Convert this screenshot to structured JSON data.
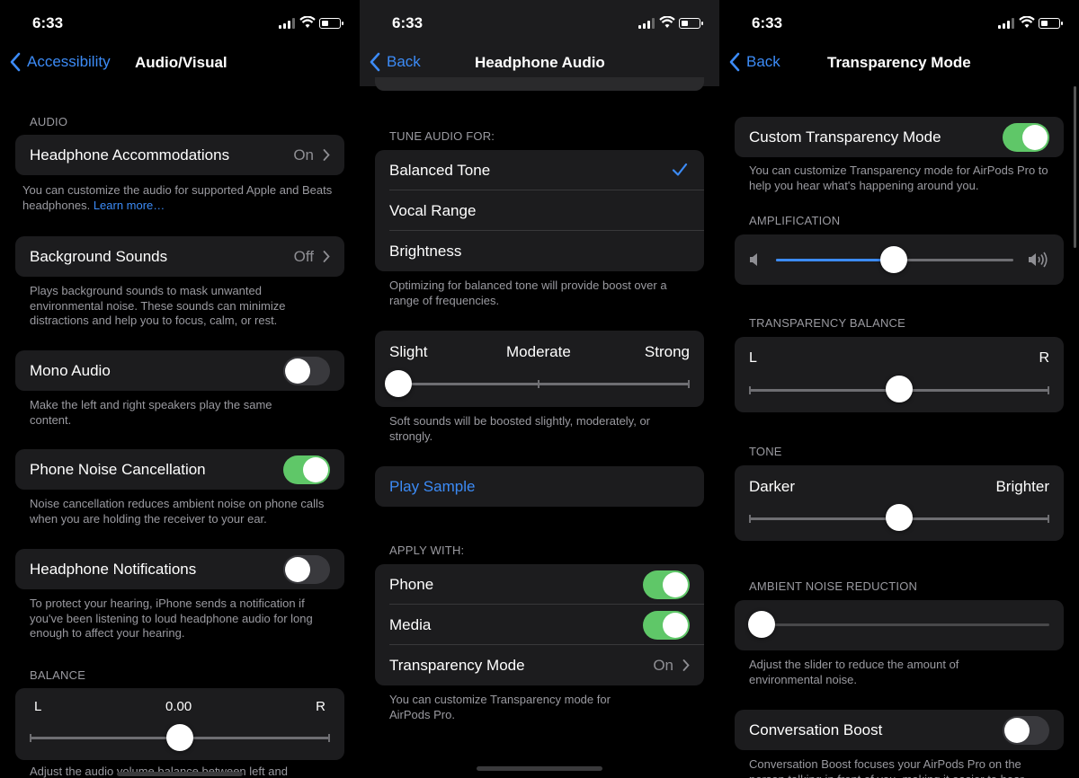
{
  "status": {
    "time": "6:33"
  },
  "panel1": {
    "nav": {
      "back": "Accessibility",
      "title": "Audio/Visual"
    },
    "audio_header": "AUDIO",
    "headphone_accommodations": {
      "label": "Headphone Accommodations",
      "value": "On"
    },
    "ha_footer": "You can customize the audio for supported Apple and Beats headphones.",
    "ha_link": "Learn more…",
    "background_sounds": {
      "label": "Background Sounds",
      "value": "Off"
    },
    "bs_footer": "Plays background sounds to mask unwanted environmental noise. These sounds can minimize distractions and help you to focus, calm, or rest.",
    "mono_audio": {
      "label": "Mono Audio",
      "on": false
    },
    "mono_footer": "Make the left and right speakers play the same content.",
    "phone_noise": {
      "label": "Phone Noise Cancellation",
      "on": true
    },
    "pn_footer": "Noise cancellation reduces ambient noise on phone calls when you are holding the receiver to your ear.",
    "headphone_notifications": {
      "label": "Headphone Notifications",
      "on": false
    },
    "hn_footer": "To protect your hearing, iPhone sends a notification if you've been listening to loud headphone audio for long enough to affect your hearing.",
    "balance_header": "BALANCE",
    "balance": {
      "left": "L",
      "value": "0.00",
      "right": "R",
      "level": 0.5
    },
    "balance_footer": "Adjust the audio volume balance between left and"
  },
  "panel2": {
    "nav": {
      "back": "Back",
      "title": "Headphone Audio"
    },
    "tune_header": "TUNE AUDIO FOR:",
    "tune_options": [
      {
        "label": "Balanced Tone",
        "selected": true
      },
      {
        "label": "Vocal Range",
        "selected": false
      },
      {
        "label": "Brightness",
        "selected": false
      }
    ],
    "tune_footer": "Optimizing for balanced tone will provide boost over a range of frequencies.",
    "boost": {
      "slight": "Slight",
      "moderate": "Moderate",
      "strong": "Strong",
      "level": 0.0
    },
    "boost_footer": "Soft sounds will be boosted slightly, moderately, or strongly.",
    "play_sample": "Play Sample",
    "apply_header": "APPLY WITH:",
    "phone": {
      "label": "Phone",
      "on": true
    },
    "media": {
      "label": "Media",
      "on": true
    },
    "transparency": {
      "label": "Transparency Mode",
      "value": "On"
    },
    "apply_footer": "You can customize Transparency mode for AirPods Pro."
  },
  "panel3": {
    "nav": {
      "back": "Back",
      "title": "Transparency Mode"
    },
    "custom": {
      "label": "Custom Transparency Mode",
      "on": true
    },
    "custom_footer": "You can customize Transparency mode for AirPods Pro to help you hear what's happening around you.",
    "amplification_header": "AMPLIFICATION",
    "amplification_level": 0.5,
    "balance_header": "TRANSPARENCY BALANCE",
    "balance": {
      "left": "L",
      "right": "R",
      "level": 0.5
    },
    "tone_header": "TONE",
    "tone": {
      "darker": "Darker",
      "brighter": "Brighter",
      "level": 0.5
    },
    "anr_header": "AMBIENT NOISE REDUCTION",
    "anr_level": 0.0,
    "anr_footer": "Adjust the slider to reduce the amount of environmental noise.",
    "conversation_boost": {
      "label": "Conversation Boost",
      "on": false
    },
    "cb_footer": "Conversation Boost focuses your AirPods Pro on the person talking in front of you, making it easier to hear"
  },
  "colors": {
    "accent": "#3c8bf6",
    "toggle_on": "#5fc768",
    "cell": "#1c1c1e"
  }
}
